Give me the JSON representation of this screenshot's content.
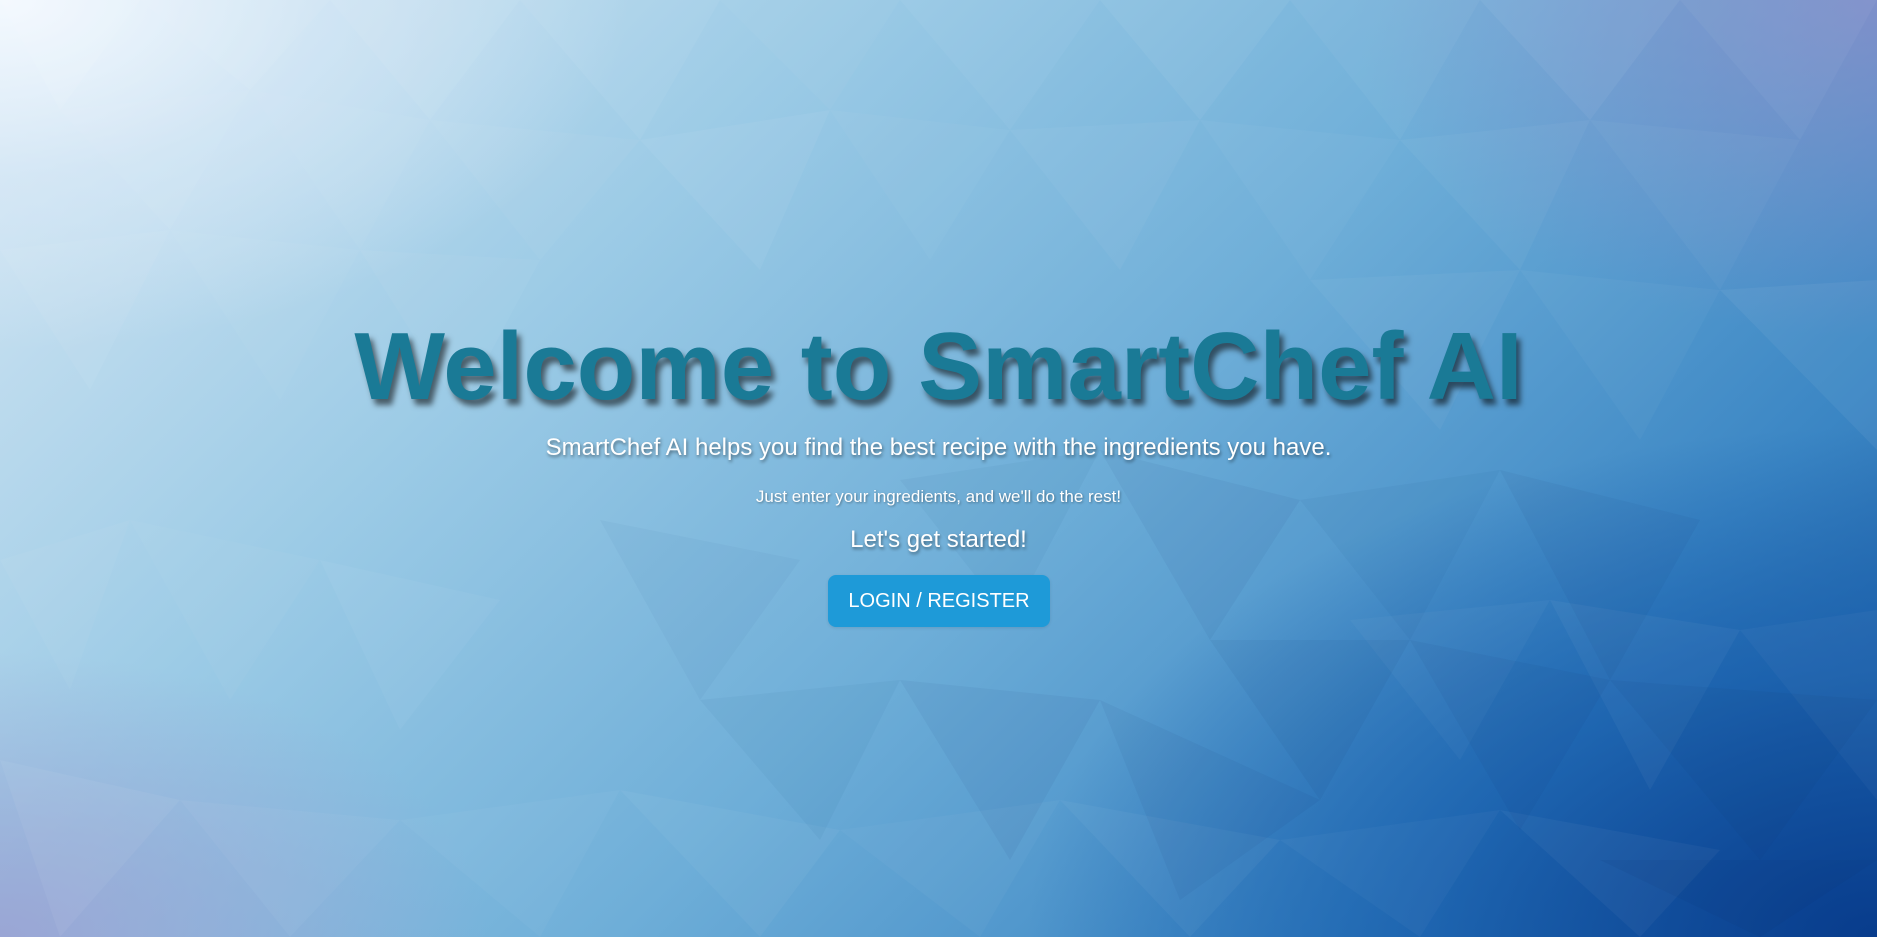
{
  "hero": {
    "title": "Welcome to SmartChef AI",
    "subtitle": "SmartChef AI helps you find the best recipe with the ingredients you have.",
    "tagline": "Just enter your ingredients, and we'll do the rest!",
    "call_to_action": "Let's get started!",
    "login_button_label": "LOGIN / REGISTER"
  },
  "colors": {
    "title": "#1a7a96",
    "button_bg": "#1e9ad8",
    "text": "#ffffff"
  }
}
